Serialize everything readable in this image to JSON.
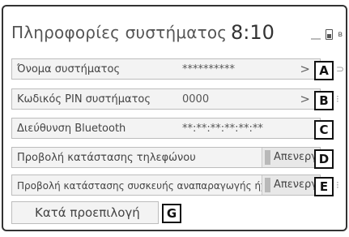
{
  "header": {
    "title": "Πληροφορίες συστήματος",
    "clock": "8:10",
    "icons": [
      "signal-icon",
      "battery-icon",
      "bluetooth-icon"
    ],
    "bluetooth_glyph": "ʙ"
  },
  "rows": [
    {
      "label": "Όνομα συστήματος",
      "value": "**********",
      "chevron": ">",
      "badge": "A"
    },
    {
      "label": "Κωδικός PIN συστήματος",
      "value": "0000",
      "chevron": ">",
      "badge": "B"
    },
    {
      "label": "Διεύθυνση Bluetooth",
      "value": "**:**:**:**:**:**",
      "badge": "C"
    },
    {
      "label": "Προβολή κατάστασης τηλεφώνου",
      "toggle": "Απενεργ.",
      "badge": "D"
    },
    {
      "label": "Προβολή κατάστασης συσκευής αναπαραγωγής ήχου",
      "toggle": "Απενεργ.",
      "badge": "E"
    }
  ],
  "default_button": {
    "label": "Κατά προεπιλογή",
    "badge": "G"
  }
}
